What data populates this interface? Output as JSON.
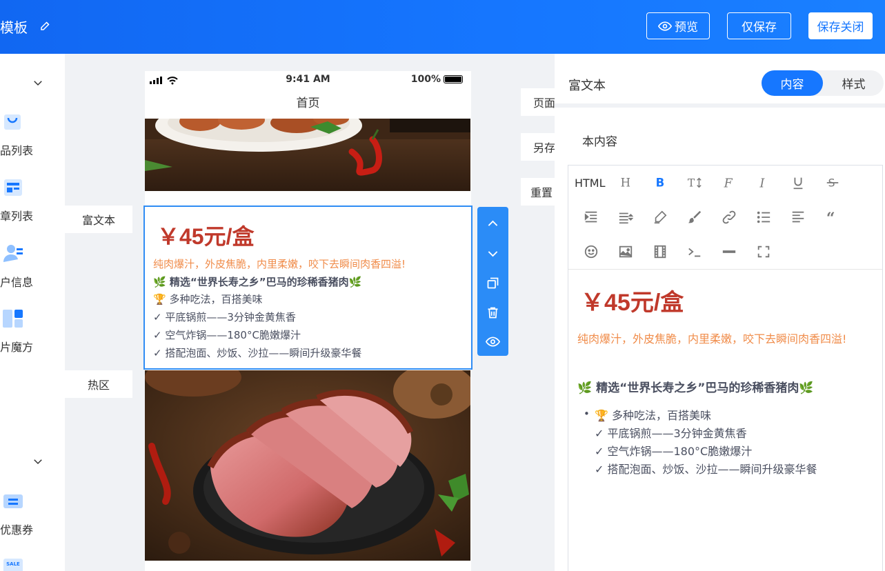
{
  "header": {
    "title": "模板",
    "preview_label": "预览",
    "save_label": "仅保存",
    "save_close_label": "保存关闭"
  },
  "sidebar": {
    "items": [
      {
        "label": "品列表",
        "icon": "bag-icon"
      },
      {
        "label": "章列表",
        "icon": "article-icon"
      },
      {
        "label": "户信息",
        "icon": "user-icon"
      },
      {
        "label": "片魔方",
        "icon": "cube-icon"
      },
      {
        "label": "优惠券",
        "icon": "coupon-icon"
      },
      {
        "label": "SALE",
        "icon": "sale-icon"
      }
    ]
  },
  "phone": {
    "time": "9:41 AM",
    "battery": "100%",
    "page_title": "首页"
  },
  "canvas": {
    "left_tags": [
      "富文本",
      "热区"
    ],
    "right_tags": [
      "页面设置",
      "另存模板",
      "重置"
    ]
  },
  "rich_text": {
    "price": "￥45元/盒",
    "subtitle": "纯肉爆汁，外皮焦脆，内里柔嫩，咬下去瞬间肉香四溢!",
    "bold_line": "🌿 精选“世界长寿之乡”巴马的珍稀香猪肉🌿",
    "lines": [
      "🏆 多种吃法，百搭美味",
      "✓ 平底锅煎——3分钟金黄焦香",
      "✓ 空气炸锅——180°C脆嫩爆汁",
      "✓ 搭配泡面、炒饭、沙拉——瞬间升级豪华餐"
    ]
  },
  "panel": {
    "title": "富文本",
    "tab_content": "内容",
    "tab_style": "样式",
    "field_label": "本内容",
    "html_label": "HTML"
  },
  "colors": {
    "primary": "#1677ff",
    "price_red": "#c0392b",
    "orange": "#f08c4a"
  }
}
